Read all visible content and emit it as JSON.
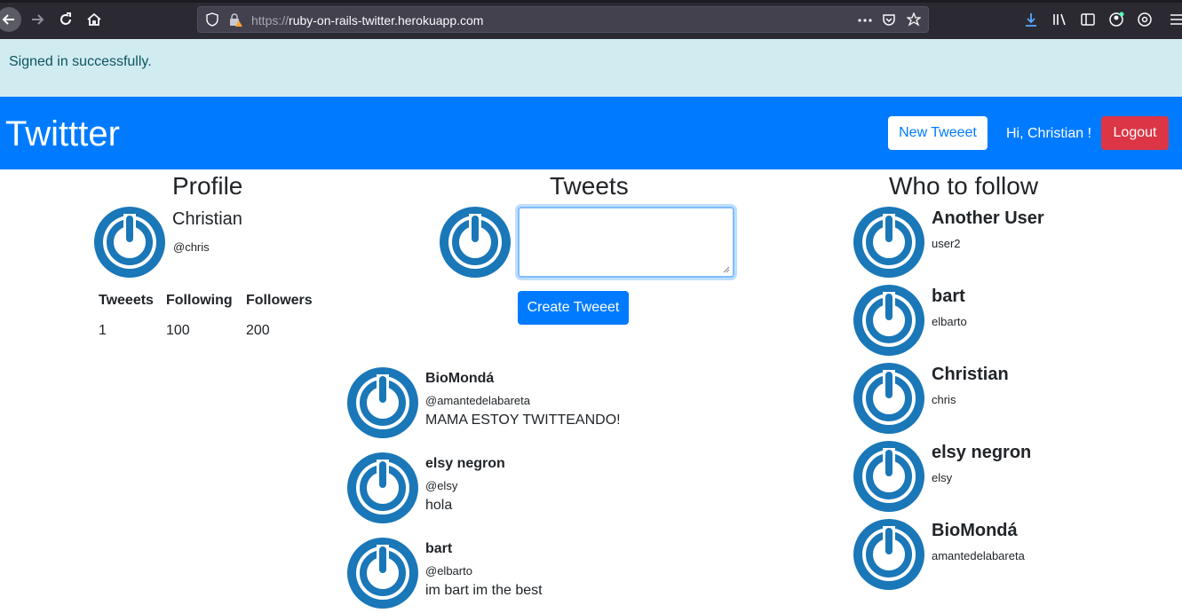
{
  "browser": {
    "url_scheme": "https://",
    "url_host": "ruby-on-rails-twitter.herokuapp.com"
  },
  "alert": {
    "text": "Signed in successfully."
  },
  "navbar": {
    "brand": "Twittter",
    "new_button": "New Tweeet",
    "greeting": "Hi, Christian !",
    "logout_button": "Logout"
  },
  "profile": {
    "heading": "Profile",
    "name": "Christian",
    "handle": "@chris",
    "stats": [
      {
        "label": "Tweeets",
        "value": "1"
      },
      {
        "label": "Following",
        "value": "100"
      },
      {
        "label": "Followers",
        "value": "200"
      }
    ]
  },
  "tweets": {
    "heading": "Tweets",
    "compose_value": "",
    "create_button": "Create Tweeet",
    "items": [
      {
        "name": "BioMondá",
        "handle": "@amantedelabareta",
        "text": "MAMA ESTOY TWITTEANDO!"
      },
      {
        "name": "elsy negron",
        "handle": "@elsy",
        "text": "hola"
      },
      {
        "name": "bart",
        "handle": "@elbarto",
        "text": "im bart im the best"
      }
    ]
  },
  "who_to_follow": {
    "heading": "Who to follow",
    "users": [
      {
        "name": "Another User",
        "handle": "user2"
      },
      {
        "name": "bart",
        "handle": "elbarto"
      },
      {
        "name": "Christian",
        "handle": "chris"
      },
      {
        "name": "elsy negron",
        "handle": "elsy"
      },
      {
        "name": "BioMondá",
        "handle": "amantedelabareta"
      }
    ]
  },
  "colors": {
    "primary": "#007bff",
    "danger": "#dc3545",
    "alert_bg": "#d1ecf1",
    "alert_text": "#0c5460",
    "avatar": "#1a77b8"
  },
  "icons": [
    "back-arrow-icon",
    "forward-arrow-icon",
    "reload-icon",
    "home-icon",
    "shield-icon",
    "lock-warning-icon",
    "more-icon",
    "pocket-icon",
    "bookmark-star-icon",
    "download-icon",
    "library-icon",
    "sidebar-icon",
    "account-icon",
    "extensions-icon",
    "menu-icon",
    "power-avatar-icon"
  ]
}
